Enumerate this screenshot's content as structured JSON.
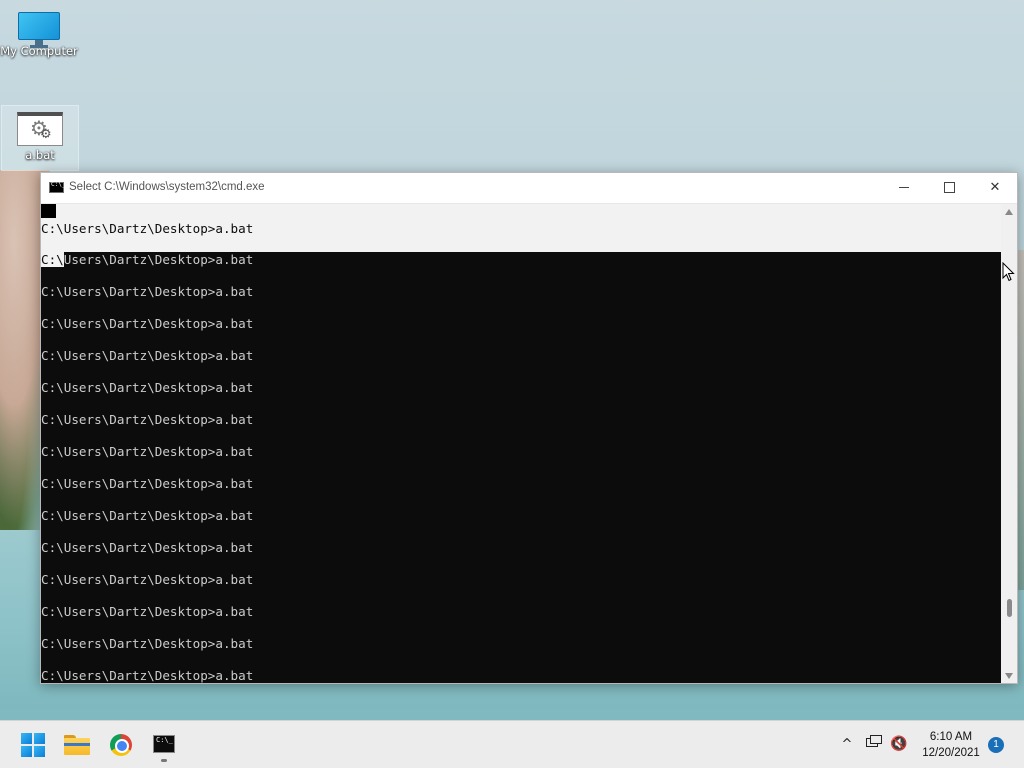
{
  "desktop": {
    "icons": [
      {
        "label": "My Computer",
        "icon": "monitor-icon"
      },
      {
        "label": "a.bat",
        "icon": "batch-file-gear-icon"
      }
    ]
  },
  "window": {
    "title": "Select C:\\Windows\\system32\\cmd.exe",
    "icon": "cmd-icon",
    "buttons": {
      "minimize": "minimize",
      "maximize": "maximize",
      "close": "✕"
    }
  },
  "console": {
    "lines": [
      "C:\\Users\\Dartz\\Desktop>a.bat",
      "C:\\Users\\Dartz\\Desktop>a.bat",
      "C:\\Users\\Dartz\\Desktop>a.bat",
      "C:\\Users\\Dartz\\Desktop>a.bat",
      "C:\\Users\\Dartz\\Desktop>a.bat",
      "C:\\Users\\Dartz\\Desktop>a.bat",
      "C:\\Users\\Dartz\\Desktop>a.bat",
      "C:\\Users\\Dartz\\Desktop>a.bat",
      "C:\\Users\\Dartz\\Desktop>a.bat",
      "C:\\Users\\Dartz\\Desktop>a.bat",
      "C:\\Users\\Dartz\\Desktop>a.bat",
      "C:\\Users\\Dartz\\Desktop>a.bat",
      "C:\\Users\\Dartz\\Desktop>a.bat",
      "C:\\Users\\Dartz\\Desktop>a.bat",
      "C:\\Users\\Dartz\\Desktop>a.bat"
    ],
    "selection_prefix": "C:\\",
    "selection_rest": "Users\\Dartz\\Desktop>a.bat"
  },
  "taskbar": {
    "apps": [
      {
        "name": "Start",
        "icon": "windows-start-icon"
      },
      {
        "name": "File Explorer",
        "icon": "folder-icon"
      },
      {
        "name": "Google Chrome",
        "icon": "chrome-icon"
      },
      {
        "name": "Command Prompt",
        "icon": "cmd-icon",
        "active": true
      }
    ],
    "tray": {
      "chevron": "^",
      "network_icon": "network-icon",
      "sound_icon": "sound-muted-icon",
      "time": "6:10 AM",
      "date": "12/20/2021",
      "notifications": "1"
    }
  },
  "colors": {
    "console_bg": "#0c0c0c",
    "console_text": "#cccccc",
    "selection_bg": "#f2f2f2",
    "taskbar_bg": "#ececec",
    "accent": "#1a6fb8"
  }
}
